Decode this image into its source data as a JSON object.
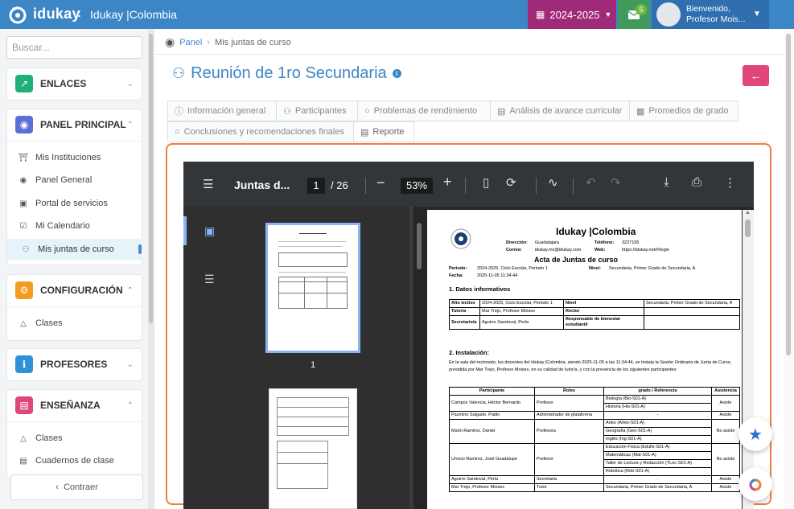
{
  "app": {
    "logo": "idukay",
    "separator": ":",
    "org": "Idukay |Colombia",
    "year": "2024-2025",
    "mail_count": "5",
    "user_line1": "Bienvenido,",
    "user_line2": "Profesor Mois..."
  },
  "sidebar": {
    "search_placeholder": "Buscar...",
    "enlaces": "ENLACES",
    "panel_principal": "PANEL PRINCIPAL",
    "panel_items": [
      "Mis Instituciones",
      "Panel General",
      "Portal de servicios",
      "Mi Calendario",
      "Mis juntas de curso"
    ],
    "configuracion": "CONFIGURACIÓN",
    "config_items": [
      "Clases"
    ],
    "profesores": "PROFESORES",
    "ensenanza": "ENSEÑANZA",
    "ensenanza_items": [
      "Clases",
      "Cuadernos de clase"
    ],
    "contraer": "Contraer"
  },
  "breadcrumb": {
    "home": "Panel",
    "current": "Mis juntas de curso"
  },
  "page": {
    "title": "Reunión de 1ro Secundaria"
  },
  "tabs": [
    "Información general",
    "Participantes",
    "Problemas de rendimiento",
    "Análisis de avance curricular",
    "Promedios de grado",
    "Conclusiones y recomendaciones finales",
    "Reporte"
  ],
  "pdf": {
    "title": "Juntas d...",
    "page": "1",
    "total": "/ 26",
    "zoom": "53%",
    "thumb_label": "1"
  },
  "doc": {
    "org": "Idukay |Colombia",
    "dir_l": "Dirección:",
    "dir_v": "Guadalajara",
    "tel_l": "Teléfono:",
    "tel_v": "3237195",
    "mail_l": "Correo:",
    "mail_v": "idukay.mx@idukay.com",
    "web_l": "Web:",
    "web_v": "https://idukay.net/#/login",
    "acta": "Acta de Juntas de curso",
    "periodo_l": "Periodo:",
    "periodo_v": "2024-2025,  Ciclo Escolar,  Periodo 1",
    "nivel_l": "Nivel:",
    "nivel_v": "Secundaria, Primer Grado de Secundaria, A",
    "fecha_l": "Fecha:",
    "fecha_v": "2025-11-05 11:34:44",
    "s1": "1. Datos informativos",
    "info": [
      [
        "Año lectivo",
        "2024-2025,  Ciclo Escolar, Periodo 1",
        "Nivel",
        "Secundaria,  Primer Grado de Secundaria,  A"
      ],
      [
        "Tutor/a",
        "Mar Trejo, Profesor Moises",
        "Rector",
        ""
      ],
      [
        "Secretario/a",
        "Aguirre Sandoval, Perla",
        "Responsable de bienestar estudiantil",
        ""
      ]
    ],
    "s2": "2. Instalación:",
    "install": "En la sala del rectorado, los docentes del Idukay |Colombia, siendo 2025-11-05 a las 11:34:44,  se instala la Sesión Ordinaria de Junta de Curso, presidida por Mar Trejo, Profesor Moises, en su calidad de tutor/a, y con la presencia de los siguientes participantes:",
    "ph": [
      "Participante",
      "Roles",
      "grado / Referencia",
      "Asistencia"
    ],
    "rows": [
      [
        "Campos Valencia, Héctor Bernardo",
        "Profesor",
        [
          "Biología  (Bio-S01-A)",
          "Historia  (His-S01-A)"
        ],
        "Asiste"
      ],
      [
        "Pazmino Salgado, Pablo",
        "Administrador de plataforma",
        [
          "-"
        ],
        "Asiste"
      ],
      [
        "Marin Ramirez, Daniel",
        "Profesora",
        [
          "Artes  (Artes-S01-A)",
          "Geografía  (Geo-S01-A)",
          "Inglés  (Ing-S01-A)"
        ],
        "No asiste"
      ],
      [
        "Urvicio Ramirez, José Guadalupe",
        "Profesor",
        [
          "Educación Física  (Edufis-S01-A)",
          "Matemáticas  (Mat-S01-A)",
          "Taller de Lectura y Redacción  (TLec-S01-A)",
          "Robótica  (Rob-S01-A)"
        ],
        "No asiste"
      ],
      [
        "Aguirre Sandoval, Perla",
        "Secretaria",
        [
          "-"
        ],
        "Asiste"
      ],
      [
        "Mar Trejo, Profesor Moises",
        "Tutor",
        [
          "Secundaria,  Primer Grado de Secundaria, A"
        ],
        "Asiste"
      ]
    ]
  }
}
